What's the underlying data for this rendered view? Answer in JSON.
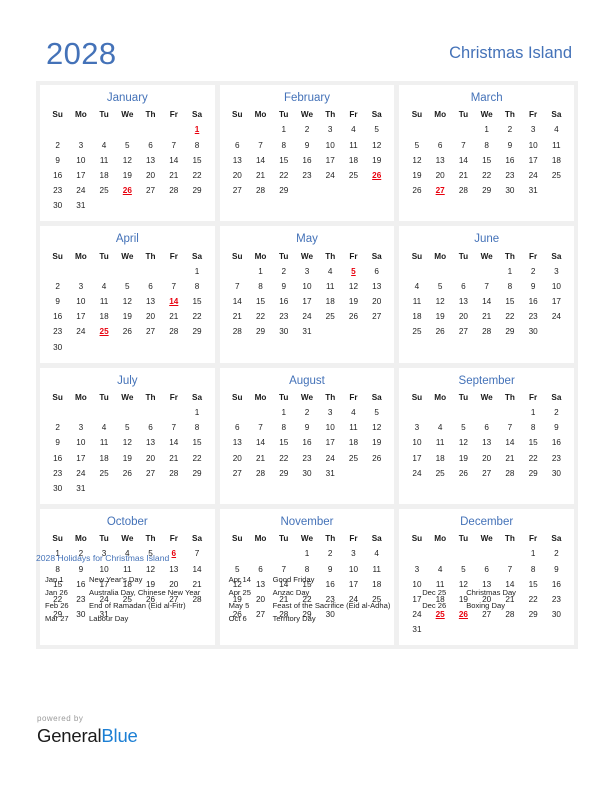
{
  "header": {
    "year": "2028",
    "country": "Christmas Island",
    "accent_color": "#4472b8",
    "holiday_color": "#e8000d"
  },
  "weekday_headers": [
    "Su",
    "Mo",
    "Tu",
    "We",
    "Th",
    "Fr",
    "Sa"
  ],
  "months": [
    {
      "name": "January",
      "lead_blanks": 6,
      "days": 31,
      "holidays": [
        1,
        26
      ]
    },
    {
      "name": "February",
      "lead_blanks": 2,
      "days": 29,
      "holidays": [
        26
      ]
    },
    {
      "name": "March",
      "lead_blanks": 3,
      "days": 31,
      "holidays": [
        27
      ]
    },
    {
      "name": "April",
      "lead_blanks": 6,
      "days": 30,
      "holidays": [
        14,
        25
      ]
    },
    {
      "name": "May",
      "lead_blanks": 1,
      "days": 31,
      "holidays": [
        5
      ]
    },
    {
      "name": "June",
      "lead_blanks": 4,
      "days": 30,
      "holidays": []
    },
    {
      "name": "July",
      "lead_blanks": 6,
      "days": 31,
      "holidays": []
    },
    {
      "name": "August",
      "lead_blanks": 2,
      "days": 31,
      "holidays": []
    },
    {
      "name": "September",
      "lead_blanks": 5,
      "days": 30,
      "holidays": []
    },
    {
      "name": "October",
      "lead_blanks": 0,
      "days": 31,
      "holidays": [
        6
      ]
    },
    {
      "name": "November",
      "lead_blanks": 3,
      "days": 30,
      "holidays": []
    },
    {
      "name": "December",
      "lead_blanks": 5,
      "days": 31,
      "holidays": [
        25,
        26
      ]
    }
  ],
  "holidays_section": {
    "heading": "2028 Holidays for Christmas Island",
    "columns": [
      [
        {
          "date": "Jan 1",
          "name": "New Year's Day"
        },
        {
          "date": "Jan 26",
          "name": "Australia Day, Chinese New Year"
        },
        {
          "date": "Feb 26",
          "name": "End of Ramadan (Eid al-Fitr)"
        },
        {
          "date": "Mar 27",
          "name": "Labour Day"
        }
      ],
      [
        {
          "date": "Apr 14",
          "name": "Good Friday"
        },
        {
          "date": "Apr 25",
          "name": "Anzac Day"
        },
        {
          "date": "May 5",
          "name": "Feast of the Sacrifice (Eid al-Adha)"
        },
        {
          "date": "Oct 6",
          "name": "Territory Day"
        }
      ],
      [
        {
          "date": "Dec 25",
          "name": "Christmas Day"
        },
        {
          "date": "Dec 26",
          "name": "Boxing Day"
        }
      ]
    ]
  },
  "footer": {
    "powered_by": "powered by",
    "brand_first": "General",
    "brand_second": "Blue"
  }
}
